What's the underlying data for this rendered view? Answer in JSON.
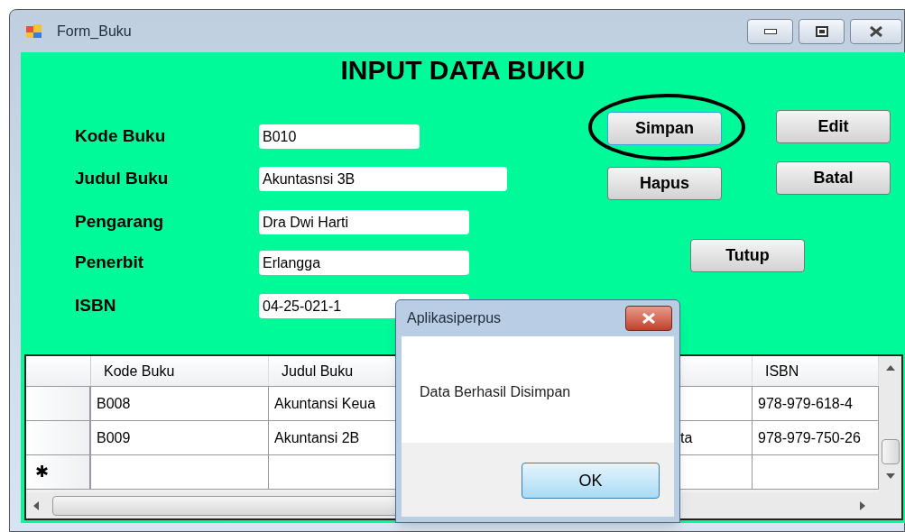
{
  "window": {
    "title": "Form_Buku"
  },
  "form": {
    "heading": "INPUT DATA BUKU",
    "fields": [
      {
        "label": "Kode Buku",
        "value": "B010"
      },
      {
        "label": "Judul Buku",
        "value": "Akuntasnsi 3B"
      },
      {
        "label": "Pengarang",
        "value": "Dra Dwi Harti"
      },
      {
        "label": "Penerbit",
        "value": "Erlangga"
      },
      {
        "label": "ISBN",
        "value": "04-25-021-1"
      }
    ],
    "buttons": [
      {
        "label": "Simpan",
        "focused": true,
        "circled": true
      },
      {
        "label": "Edit",
        "focused": false,
        "circled": false
      },
      {
        "label": "Hapus",
        "focused": false,
        "circled": false
      },
      {
        "label": "Batal",
        "focused": false,
        "circled": false
      },
      {
        "label": "Tutup",
        "focused": false,
        "circled": false
      }
    ]
  },
  "table": {
    "columns": [
      {
        "label": "Kode Buku"
      },
      {
        "label": "Judul Buku"
      },
      {},
      {
        "label": "ISBN"
      }
    ],
    "rows": [
      {
        "cells": [
          "B008",
          "Akuntansi Keua",
          null,
          "978-979-618-4"
        ]
      },
      {
        "cells": [
          "B009",
          "Akuntansi 2B",
          "ta",
          "978-979-750-26"
        ]
      }
    ],
    "new_row_marker": "✱"
  },
  "dialog": {
    "title": "Aplikasiperpus",
    "message": "Data Berhasil Disimpan",
    "button": "OK"
  }
}
